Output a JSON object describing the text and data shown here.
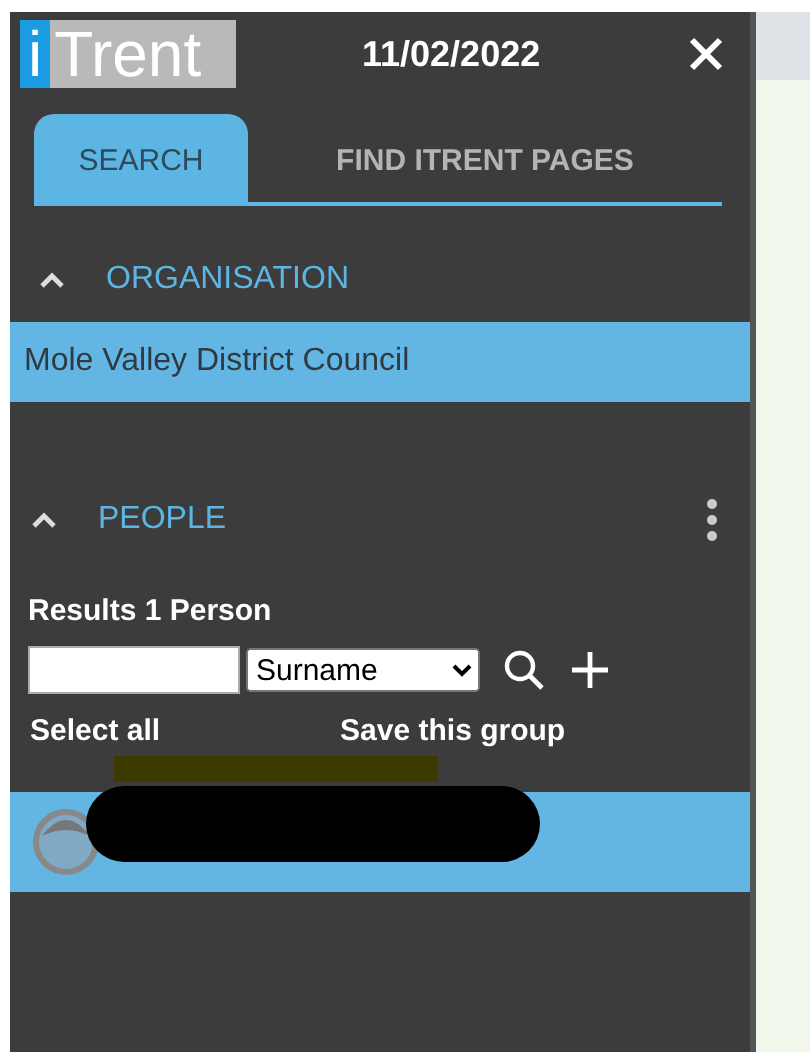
{
  "header": {
    "logo": {
      "mark": "i",
      "text": "Trent"
    },
    "date": "11/02/2022"
  },
  "tabs": [
    {
      "label": "SEARCH",
      "selected": true
    },
    {
      "label": "FIND ITRENT PAGES",
      "selected": false
    }
  ],
  "organisation": {
    "title": "ORGANISATION",
    "expanded": true,
    "items": [
      {
        "label": "Mole Valley District Council",
        "selected": true
      }
    ]
  },
  "people": {
    "title": "PEOPLE",
    "expanded": true,
    "results": "Results 1 Person",
    "search_type": "Surname",
    "select_all": "Select all",
    "save_group": "Save this group",
    "persons": [
      {
        "selected": true,
        "redacted": true
      }
    ]
  }
}
